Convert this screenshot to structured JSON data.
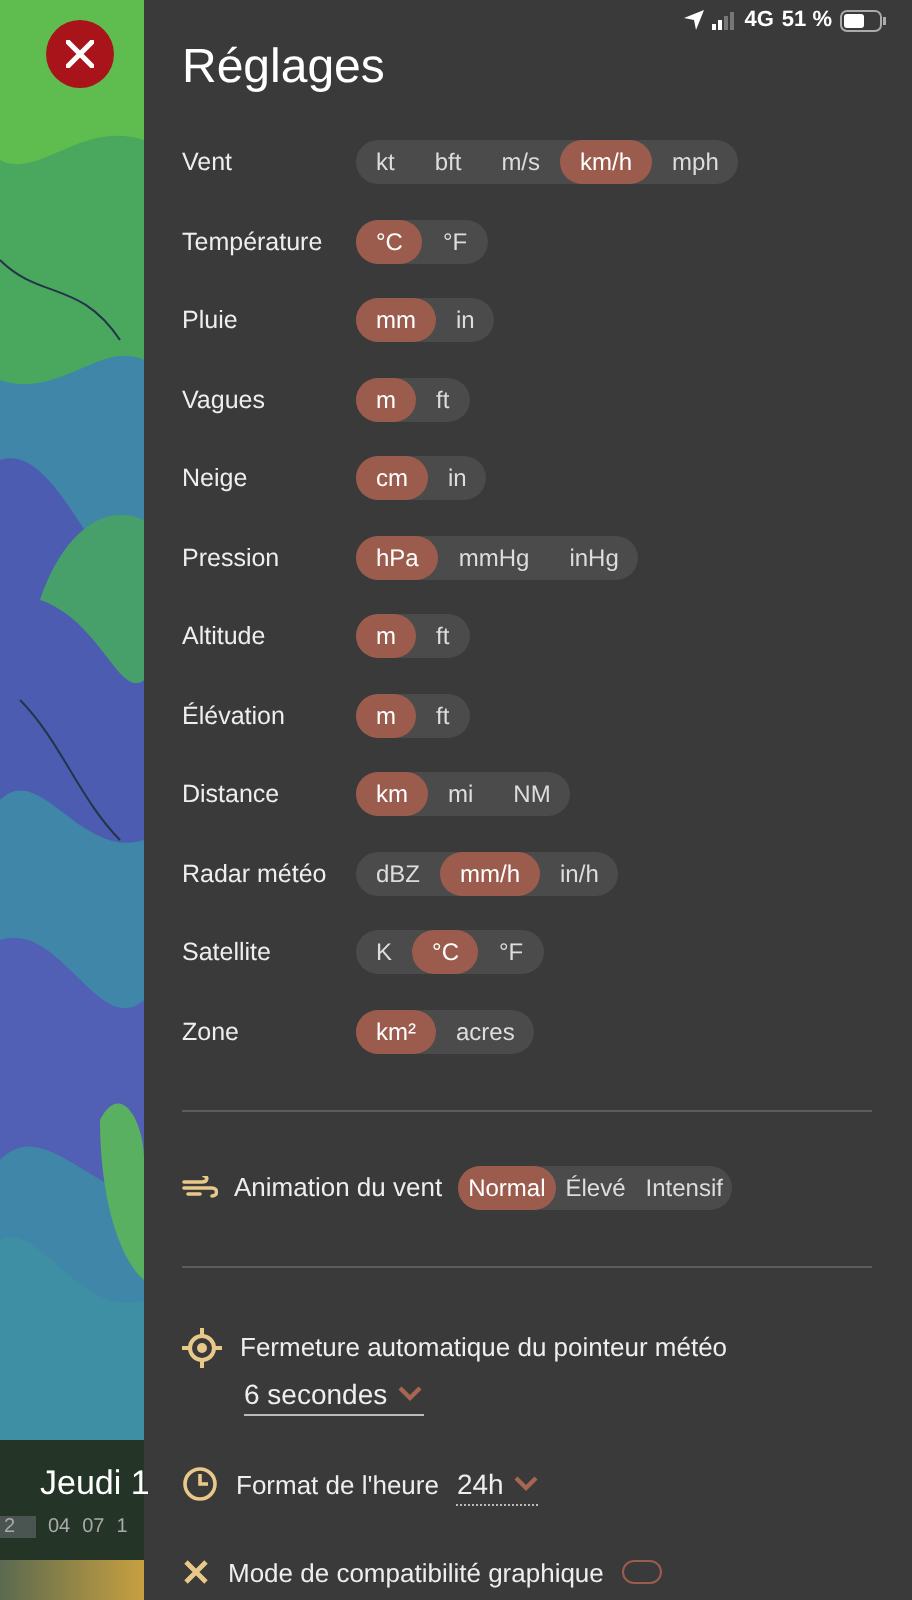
{
  "status_bar": {
    "network": "4G",
    "battery": "51 %"
  },
  "title": "Réglages",
  "units": [
    {
      "label": "Vent",
      "options": [
        {
          "label": "kt",
          "selected": false
        },
        {
          "label": "bft",
          "selected": false
        },
        {
          "label": "m/s",
          "selected": false
        },
        {
          "label": "km/h",
          "selected": true
        },
        {
          "label": "mph",
          "selected": false
        }
      ]
    },
    {
      "label": "Température",
      "options": [
        {
          "label": "°C",
          "selected": true
        },
        {
          "label": "°F",
          "selected": false
        }
      ]
    },
    {
      "label": "Pluie",
      "options": [
        {
          "label": "mm",
          "selected": true
        },
        {
          "label": "in",
          "selected": false
        }
      ]
    },
    {
      "label": "Vagues",
      "options": [
        {
          "label": "m",
          "selected": true
        },
        {
          "label": "ft",
          "selected": false
        }
      ]
    },
    {
      "label": "Neige",
      "options": [
        {
          "label": "cm",
          "selected": true
        },
        {
          "label": "in",
          "selected": false
        }
      ]
    },
    {
      "label": "Pression",
      "options": [
        {
          "label": "hPa",
          "selected": true
        },
        {
          "label": "mmHg",
          "selected": false
        },
        {
          "label": "inHg",
          "selected": false
        }
      ]
    },
    {
      "label": "Altitude",
      "options": [
        {
          "label": "m",
          "selected": true
        },
        {
          "label": "ft",
          "selected": false
        }
      ]
    },
    {
      "label": "Élévation",
      "options": [
        {
          "label": "m",
          "selected": true
        },
        {
          "label": "ft",
          "selected": false
        }
      ]
    },
    {
      "label": "Distance",
      "options": [
        {
          "label": "km",
          "selected": true
        },
        {
          "label": "mi",
          "selected": false
        },
        {
          "label": "NM",
          "selected": false
        }
      ]
    },
    {
      "label": "Radar météo",
      "options": [
        {
          "label": "dBZ",
          "selected": false
        },
        {
          "label": "mm/h",
          "selected": true
        },
        {
          "label": "in/h",
          "selected": false
        }
      ]
    },
    {
      "label": "Satellite",
      "options": [
        {
          "label": "K",
          "selected": false
        },
        {
          "label": "°C",
          "selected": true
        },
        {
          "label": "°F",
          "selected": false
        }
      ]
    },
    {
      "label": "Zone",
      "options": [
        {
          "label": "km²",
          "selected": true
        },
        {
          "label": "acres",
          "selected": false
        }
      ]
    }
  ],
  "wind_animation": {
    "label": "Animation du vent",
    "options": [
      {
        "label": "Normal",
        "selected": true
      },
      {
        "label": "Élevé",
        "selected": false
      },
      {
        "label": "Intensif",
        "selected": false
      }
    ]
  },
  "pointer_close": {
    "label": "Fermeture automatique du pointeur météo",
    "value": "6 secondes"
  },
  "time_format": {
    "label": "Format de l'heure",
    "value": "24h"
  },
  "graphics_mode": {
    "label": "Mode de compatibilité graphique",
    "on": false
  },
  "timeline": {
    "day": "Jeudi 1",
    "hours": [
      "2",
      "04",
      "07",
      "1"
    ]
  }
}
